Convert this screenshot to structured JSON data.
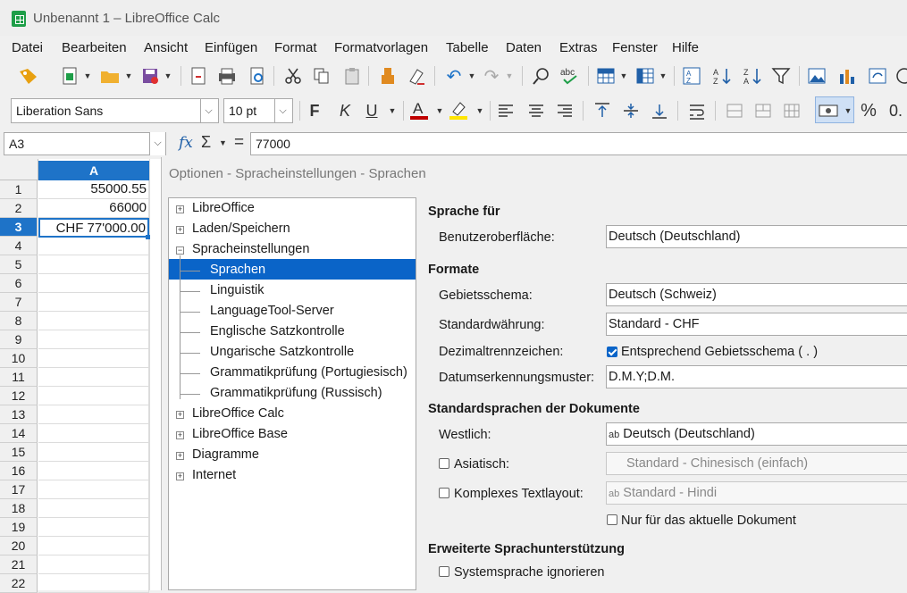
{
  "window": {
    "title": "Unbenannt 1 – LibreOffice Calc"
  },
  "menu": [
    "Datei",
    "Bearbeiten",
    "Ansicht",
    "Einfügen",
    "Format",
    "Formatvorlagen",
    "Tabelle",
    "Daten",
    "Extras",
    "Fenster",
    "Hilfe"
  ],
  "toolbar": {
    "font_name": "Liberation Sans",
    "font_size": "10 pt",
    "bold_label": "F",
    "italic_label": "K",
    "underline_label": "U",
    "percent_label": "%",
    "zero_label": "0.",
    "font_color": "#c00000",
    "highlight_color": "#ffe500"
  },
  "formula": {
    "cell_ref": "A3",
    "content": "77000",
    "fx": "fx",
    "sigma": "Σ",
    "equals": "="
  },
  "sheet": {
    "column_header": "A",
    "rows": [
      "1",
      "2",
      "3",
      "4",
      "5",
      "6",
      "7",
      "8",
      "9",
      "10",
      "11",
      "12",
      "13",
      "14",
      "15",
      "16",
      "17",
      "18",
      "19",
      "20",
      "21",
      "22"
    ],
    "cells": [
      "55000.55",
      "66000",
      "CHF 77'000.00"
    ],
    "selected_row": 3,
    "accent": "#1e73c8"
  },
  "dialog": {
    "title": "Optionen - Spracheinstellungen - Sprachen",
    "tree": {
      "top": [
        "LibreOffice",
        "Laden/Speichern",
        "Spracheinstellungen"
      ],
      "children": [
        "Sprachen",
        "Linguistik",
        "LanguageTool-Server",
        "Englische Satzkontrolle",
        "Ungarische Satzkontrolle",
        "Grammatikprüfung (Portugiesisch)",
        "Grammatikprüfung (Russisch)"
      ],
      "rest": [
        "LibreOffice Calc",
        "LibreOffice Base",
        "Diagramme",
        "Internet"
      ],
      "selected_color": "#0a64c8"
    },
    "sprache_fuer": {
      "header": "Sprache für",
      "ui_label": "Benutzeroberfläche:",
      "ui_value": "Deutsch (Deutschland)"
    },
    "formate": {
      "header": "Formate",
      "locale_label": "Gebietsschema:",
      "locale_value": "Deutsch (Schweiz)",
      "currency_label": "Standardwährung:",
      "currency_value": "Standard - CHF",
      "decimal_label": "Dezimaltrennzeichen:",
      "decimal_check_label": "Entsprechend Gebietsschema ( . )",
      "date_label": "Datumserkennungsmuster:",
      "date_value": "D.M.Y;D.M."
    },
    "standardsprachen": {
      "header": "Standardsprachen der Dokumente",
      "western_label": "Westlich:",
      "western_value": "Deutsch (Deutschland)",
      "asian_label": "Asiatisch:",
      "asian_value": "Standard - Chinesisch (einfach)",
      "ctl_label": "Komplexes Textlayout:",
      "ctl_value": "Standard - Hindi",
      "current_doc_label": "Nur für das aktuelle Dokument",
      "spell_icon": "ab"
    },
    "erweitert": {
      "header": "Erweiterte Sprachunterstützung",
      "ignore_label": "Systemsprache ignorieren"
    }
  }
}
